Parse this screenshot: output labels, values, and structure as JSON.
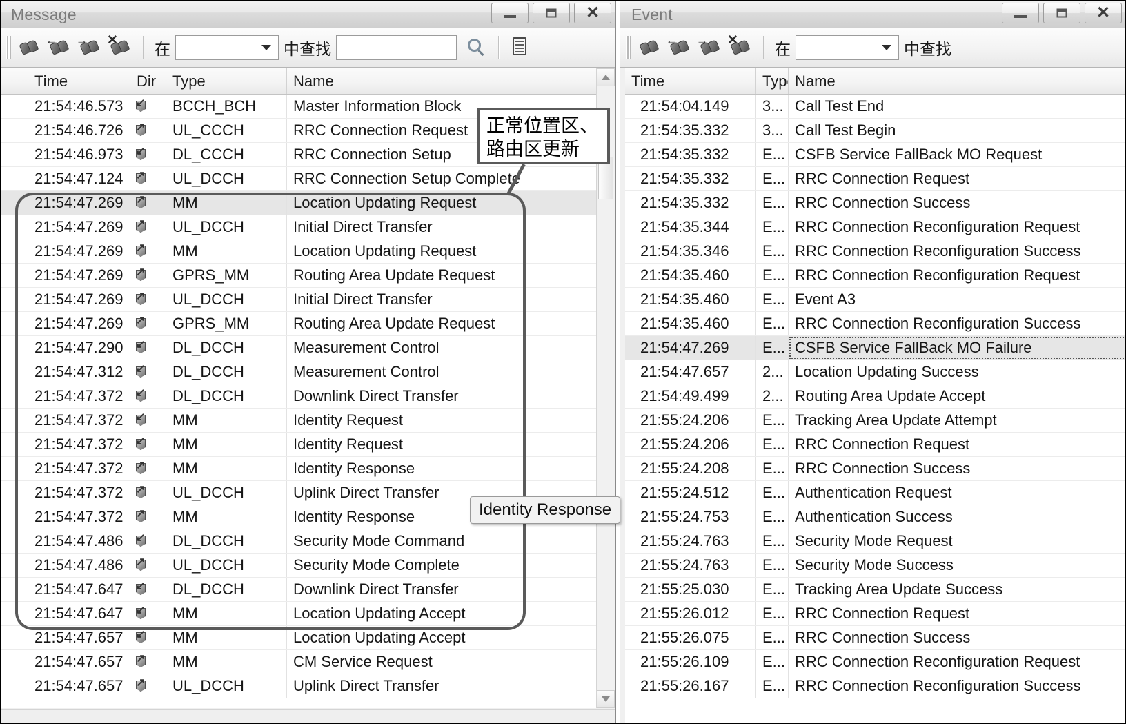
{
  "message_window": {
    "title": "Message",
    "window_buttons": {
      "minimize": "minimize-icon",
      "maximize": "maximize-icon",
      "close": "close-icon"
    },
    "toolbar": {
      "icons": [
        "find-icon",
        "find-previous-icon",
        "find-next-icon",
        "find-clear-icon"
      ],
      "in_label": "在",
      "scope_combo_value": "",
      "find_label": "中查找",
      "search_value": "",
      "search_button_icon": "search-icon",
      "report_button_icon": "report-icon"
    },
    "columns": [
      "",
      "Time",
      "Dir",
      "Type",
      "Name"
    ],
    "rows": [
      {
        "time": "21:54:46.573",
        "dir": "down",
        "type": "BCCH_BCH",
        "name": "Master Information Block",
        "selected": false
      },
      {
        "time": "21:54:46.726",
        "dir": "up",
        "type": "UL_CCCH",
        "name": "RRC Connection Request",
        "selected": false
      },
      {
        "time": "21:54:46.973",
        "dir": "down",
        "type": "DL_CCCH",
        "name": "RRC Connection Setup",
        "selected": false
      },
      {
        "time": "21:54:47.124",
        "dir": "up",
        "type": "UL_DCCH",
        "name": "RRC Connection Setup Complete",
        "selected": false
      },
      {
        "time": "21:54:47.269",
        "dir": "up",
        "type": "MM",
        "name": "Location Updating Request",
        "selected": true
      },
      {
        "time": "21:54:47.269",
        "dir": "up",
        "type": "UL_DCCH",
        "name": "Initial Direct Transfer",
        "selected": false
      },
      {
        "time": "21:54:47.269",
        "dir": "up",
        "type": "MM",
        "name": "Location Updating Request",
        "selected": false
      },
      {
        "time": "21:54:47.269",
        "dir": "up",
        "type": "GPRS_MM",
        "name": "Routing Area Update Request",
        "selected": false
      },
      {
        "time": "21:54:47.269",
        "dir": "up",
        "type": "UL_DCCH",
        "name": "Initial Direct Transfer",
        "selected": false
      },
      {
        "time": "21:54:47.269",
        "dir": "up",
        "type": "GPRS_MM",
        "name": "Routing Area Update Request",
        "selected": false
      },
      {
        "time": "21:54:47.290",
        "dir": "down",
        "type": "DL_DCCH",
        "name": "Measurement Control",
        "selected": false
      },
      {
        "time": "21:54:47.312",
        "dir": "down",
        "type": "DL_DCCH",
        "name": "Measurement Control",
        "selected": false
      },
      {
        "time": "21:54:47.372",
        "dir": "down",
        "type": "DL_DCCH",
        "name": "Downlink Direct Transfer",
        "selected": false
      },
      {
        "time": "21:54:47.372",
        "dir": "down",
        "type": "MM",
        "name": "Identity Request",
        "selected": false
      },
      {
        "time": "21:54:47.372",
        "dir": "down",
        "type": "MM",
        "name": "Identity Request",
        "selected": false
      },
      {
        "time": "21:54:47.372",
        "dir": "up",
        "type": "MM",
        "name": "Identity Response",
        "selected": false
      },
      {
        "time": "21:54:47.372",
        "dir": "up",
        "type": "UL_DCCH",
        "name": "Uplink Direct Transfer",
        "selected": false
      },
      {
        "time": "21:54:47.372",
        "dir": "up",
        "type": "MM",
        "name": "Identity Response",
        "selected": false
      },
      {
        "time": "21:54:47.486",
        "dir": "down",
        "type": "DL_DCCH",
        "name": "Security Mode Command",
        "selected": false
      },
      {
        "time": "21:54:47.486",
        "dir": "up",
        "type": "UL_DCCH",
        "name": "Security Mode Complete",
        "selected": false
      },
      {
        "time": "21:54:47.647",
        "dir": "down",
        "type": "DL_DCCH",
        "name": "Downlink Direct Transfer",
        "selected": false
      },
      {
        "time": "21:54:47.647",
        "dir": "down",
        "type": "MM",
        "name": "Location Updating Accept",
        "selected": false
      },
      {
        "time": "21:54:47.657",
        "dir": "down",
        "type": "MM",
        "name": "Location Updating Accept",
        "selected": false
      },
      {
        "time": "21:54:47.657",
        "dir": "up",
        "type": "MM",
        "name": "CM Service Request",
        "selected": false
      },
      {
        "time": "21:54:47.657",
        "dir": "up",
        "type": "UL_DCCH",
        "name": "Uplink Direct Transfer",
        "selected": false
      }
    ]
  },
  "event_window": {
    "title": "Event",
    "window_buttons": {
      "minimize": "minimize-icon",
      "maximize": "maximize-icon",
      "close": "close-icon"
    },
    "toolbar": {
      "icons": [
        "find-icon",
        "find-previous-icon",
        "find-next-icon",
        "find-clear-icon"
      ],
      "in_label": "在",
      "scope_combo_value": "",
      "find_label": "中查找"
    },
    "columns": [
      "Time",
      "Type",
      "Name"
    ],
    "rows": [
      {
        "time": "21:54:04.149",
        "type": "3...",
        "name": "Call Test End",
        "selected": false
      },
      {
        "time": "21:54:35.332",
        "type": "3...",
        "name": "Call Test Begin",
        "selected": false
      },
      {
        "time": "21:54:35.332",
        "type": "E...",
        "name": "CSFB Service FallBack MO Request",
        "selected": false
      },
      {
        "time": "21:54:35.332",
        "type": "E...",
        "name": "RRC Connection Request",
        "selected": false
      },
      {
        "time": "21:54:35.332",
        "type": "E...",
        "name": "RRC Connection Success",
        "selected": false
      },
      {
        "time": "21:54:35.344",
        "type": "E...",
        "name": "RRC Connection Reconfiguration Request",
        "selected": false
      },
      {
        "time": "21:54:35.346",
        "type": "E...",
        "name": "RRC Connection Reconfiguration Success",
        "selected": false
      },
      {
        "time": "21:54:35.460",
        "type": "E...",
        "name": "RRC Connection Reconfiguration Request",
        "selected": false
      },
      {
        "time": "21:54:35.460",
        "type": "E...",
        "name": "Event A3",
        "selected": false
      },
      {
        "time": "21:54:35.460",
        "type": "E...",
        "name": "RRC Connection Reconfiguration Success",
        "selected": false
      },
      {
        "time": "21:54:47.269",
        "type": "E...",
        "name": "CSFB Service FallBack MO Failure",
        "selected": true
      },
      {
        "time": "21:54:47.657",
        "type": "2...",
        "name": "Location Updating Success",
        "selected": false
      },
      {
        "time": "21:54:49.499",
        "type": "2...",
        "name": "Routing Area Update Accept",
        "selected": false
      },
      {
        "time": "21:55:24.206",
        "type": "E...",
        "name": "Tracking Area Update Attempt",
        "selected": false
      },
      {
        "time": "21:55:24.206",
        "type": "E...",
        "name": "RRC Connection Request",
        "selected": false
      },
      {
        "time": "21:55:24.208",
        "type": "E...",
        "name": "RRC Connection Success",
        "selected": false
      },
      {
        "time": "21:55:24.512",
        "type": "E...",
        "name": "Authentication Request",
        "selected": false
      },
      {
        "time": "21:55:24.753",
        "type": "E...",
        "name": "Authentication Success",
        "selected": false
      },
      {
        "time": "21:55:24.763",
        "type": "E...",
        "name": "Security Mode Request",
        "selected": false
      },
      {
        "time": "21:55:24.763",
        "type": "E...",
        "name": "Security Mode Success",
        "selected": false
      },
      {
        "time": "21:55:25.030",
        "type": "E...",
        "name": "Tracking Area Update Success",
        "selected": false
      },
      {
        "time": "21:55:26.012",
        "type": "E...",
        "name": "RRC Connection Request",
        "selected": false
      },
      {
        "time": "21:55:26.075",
        "type": "E...",
        "name": "RRC Connection Success",
        "selected": false
      },
      {
        "time": "21:55:26.109",
        "type": "E...",
        "name": "RRC Connection Reconfiguration Request",
        "selected": false
      },
      {
        "time": "21:55:26.167",
        "type": "E...",
        "name": "RRC Connection Reconfiguration Success",
        "selected": false
      }
    ]
  },
  "annotations": {
    "callout_text": "正常位置区、\n路由区更新",
    "tooltip_text": "Identity Response"
  }
}
